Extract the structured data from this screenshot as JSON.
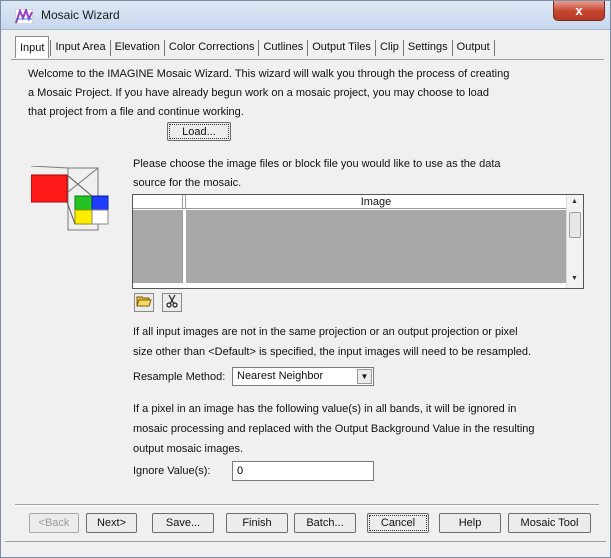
{
  "window": {
    "title": "Mosaic Wizard",
    "close_glyph": "x"
  },
  "tabs": [
    {
      "label": "Input",
      "active": true
    },
    {
      "label": "Input Area"
    },
    {
      "label": "Elevation"
    },
    {
      "label": "Color Corrections"
    },
    {
      "label": "Cutlines"
    },
    {
      "label": "Output Tiles"
    },
    {
      "label": "Clip"
    },
    {
      "label": "Settings"
    },
    {
      "label": "Output"
    }
  ],
  "intro": {
    "line1": "Welcome to the IMAGINE Mosaic Wizard. This wizard will walk you through the process of creating",
    "line2": "a Mosaic Project. If you have already begun work on a mosaic project, you may choose to load",
    "line3": "that project from a file and continue working."
  },
  "load_button": "Load...",
  "source": {
    "line1": "Please choose the image files or block file you would like to use as the data",
    "line2": "source for the mosaic."
  },
  "grid": {
    "column_header": "Image"
  },
  "icons": {
    "open": "folder-open-icon",
    "remove": "scissors-icon"
  },
  "resample_note": {
    "line1": "If all input images are not in the same projection or an output projection or pixel",
    "line2": "size other than <Default> is specified, the input images will need to be resampled."
  },
  "resample": {
    "label": "Resample Method:",
    "value": "Nearest Neighbor"
  },
  "ignore_note": {
    "line1": "If a pixel in an image has the following value(s) in all bands, it will be ignored in",
    "line2": "mosaic processing and replaced with the Output Background Value in the resulting",
    "line3": "output mosaic images."
  },
  "ignore": {
    "label": "Ignore Value(s):",
    "value": "0"
  },
  "buttons": {
    "back": "<Back",
    "next": "Next>",
    "save": "Save...",
    "finish": "Finish",
    "batch": "Batch...",
    "cancel": "Cancel",
    "help": "Help",
    "mosaic_tool": "Mosaic Tool"
  },
  "colors": {
    "red": "#ff1a1a",
    "green": "#22c322",
    "blue": "#1f3cff",
    "yellow": "#ffee00"
  }
}
